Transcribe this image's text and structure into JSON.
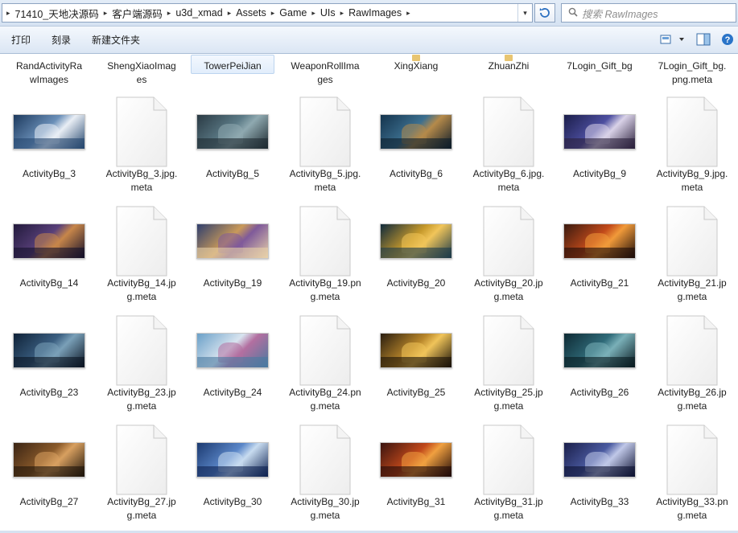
{
  "address": {
    "crumbs": [
      "71410_天地决源码",
      "客户端源码",
      "u3d_xmad",
      "Assets",
      "Game",
      "UIs",
      "RawImages"
    ],
    "search_placeholder": "搜索 RawImages"
  },
  "toolbar": {
    "print_label": "打印",
    "burn_label": "刻录",
    "new_folder_label": "新建文件夹"
  },
  "folders": [
    {
      "label": "RandActivityRa wImages",
      "lines": [
        "RandActivityRa",
        "wImages"
      ]
    },
    {
      "label": "ShengXiaoImag es",
      "lines": [
        "ShengXiaoImag",
        "es"
      ]
    },
    {
      "label": "TowerPeiJian",
      "lines": [
        "TowerPeiJian"
      ],
      "selected": true
    },
    {
      "label": "WeaponRollIma ges",
      "lines": [
        "WeaponRollIma",
        "ges"
      ]
    },
    {
      "label": "XingXiang",
      "lines": [
        "XingXiang"
      ]
    },
    {
      "label": "ZhuanZhi",
      "lines": [
        "ZhuanZhi"
      ]
    },
    {
      "label": "7Login_Gift_bg",
      "lines": [
        "7Login_Gift_bg"
      ]
    },
    {
      "label": "7Login_Gift_bg. png.meta",
      "lines": [
        "7Login_Gift_bg.",
        "png.meta"
      ]
    }
  ],
  "rows": [
    [
      {
        "type": "image",
        "lines": [
          "ActivityBg_3"
        ],
        "palette": [
          "#1d3a5e",
          "#6a8fb8",
          "#e9eef5",
          "#24466e"
        ]
      },
      {
        "type": "meta",
        "lines": [
          "ActivityBg_3.jpg.",
          "meta"
        ]
      },
      {
        "type": "image",
        "lines": [
          "ActivityBg_5"
        ],
        "palette": [
          "#2a3a44",
          "#5b7a86",
          "#8fa9b0",
          "#1e2a30"
        ]
      },
      {
        "type": "meta",
        "lines": [
          "ActivityBg_5.jpg.",
          "meta"
        ]
      },
      {
        "type": "image",
        "lines": [
          "ActivityBg_6"
        ],
        "palette": [
          "#14344d",
          "#3c6f8f",
          "#b58a4a",
          "#0c1c2a"
        ]
      },
      {
        "type": "meta",
        "lines": [
          "ActivityBg_6.jpg.",
          "meta"
        ]
      },
      {
        "type": "image",
        "lines": [
          "ActivityBg_9"
        ],
        "palette": [
          "#1b1d4a",
          "#4d4fa0",
          "#d9d2e8",
          "#2a1f3a"
        ]
      },
      {
        "type": "meta",
        "lines": [
          "ActivityBg_9.jpg.",
          "meta"
        ]
      }
    ],
    [
      {
        "type": "image",
        "lines": [
          "ActivityBg_14"
        ],
        "palette": [
          "#221a3c",
          "#59407a",
          "#c7864a",
          "#14102a"
        ]
      },
      {
        "type": "meta",
        "lines": [
          "ActivityBg_14.jp",
          "g.meta"
        ]
      },
      {
        "type": "image",
        "lines": [
          "ActivityBg_19"
        ],
        "palette": [
          "#2f3f6e",
          "#c99a5a",
          "#7f5a9a",
          "#e7d0a8"
        ]
      },
      {
        "type": "meta",
        "lines": [
          "ActivityBg_19.pn",
          "g.meta"
        ]
      },
      {
        "type": "image",
        "lines": [
          "ActivityBg_20"
        ],
        "palette": [
          "#0f2a3c",
          "#c79a2c",
          "#f1c55a",
          "#1c3a4a"
        ]
      },
      {
        "type": "meta",
        "lines": [
          "ActivityBg_20.jp",
          "g.meta"
        ]
      },
      {
        "type": "image",
        "lines": [
          "ActivityBg_21"
        ],
        "palette": [
          "#3a1a10",
          "#c24a1a",
          "#f19a3a",
          "#1c0c08"
        ]
      },
      {
        "type": "meta",
        "lines": [
          "ActivityBg_21.jp",
          "g.meta"
        ]
      }
    ],
    [
      {
        "type": "image",
        "lines": [
          "ActivityBg_23"
        ],
        "palette": [
          "#0f2238",
          "#3a5e80",
          "#7aa0b8",
          "#0a1422"
        ]
      },
      {
        "type": "meta",
        "lines": [
          "ActivityBg_23.jp",
          "g.meta"
        ]
      },
      {
        "type": "image",
        "lines": [
          "ActivityBg_24"
        ],
        "palette": [
          "#6aa0c8",
          "#d8e4ef",
          "#b36fa0",
          "#4a7aa0"
        ]
      },
      {
        "type": "meta",
        "lines": [
          "ActivityBg_24.pn",
          "g.meta"
        ]
      },
      {
        "type": "image",
        "lines": [
          "ActivityBg_25"
        ],
        "palette": [
          "#2a1e10",
          "#b8862a",
          "#f0c45a",
          "#1a1208"
        ]
      },
      {
        "type": "meta",
        "lines": [
          "ActivityBg_25.jp",
          "g.meta"
        ]
      },
      {
        "type": "image",
        "lines": [
          "ActivityBg_26"
        ],
        "palette": [
          "#0e2a34",
          "#2f6a78",
          "#7ab0b8",
          "#081a20"
        ]
      },
      {
        "type": "meta",
        "lines": [
          "ActivityBg_26.jp",
          "g.meta"
        ]
      }
    ],
    [
      {
        "type": "image",
        "lines": [
          "ActivityBg_27"
        ],
        "palette": [
          "#3a2414",
          "#8a5a2a",
          "#d8a060",
          "#1e140a"
        ]
      },
      {
        "type": "meta",
        "lines": [
          "ActivityBg_27.jp",
          "g.meta"
        ]
      },
      {
        "type": "image",
        "lines": [
          "ActivityBg_30"
        ],
        "palette": [
          "#1c3a70",
          "#5a86c8",
          "#c8dcf0",
          "#0e2250"
        ]
      },
      {
        "type": "meta",
        "lines": [
          "ActivityBg_30.jp",
          "g.meta"
        ]
      },
      {
        "type": "image",
        "lines": [
          "ActivityBg_31"
        ],
        "palette": [
          "#3a1410",
          "#c0481a",
          "#f0a040",
          "#200a08"
        ]
      },
      {
        "type": "meta",
        "lines": [
          "ActivityBg_31.jp",
          "g.meta"
        ]
      },
      {
        "type": "image",
        "lines": [
          "ActivityBg_33"
        ],
        "palette": [
          "#1a1f4a",
          "#4a5aa0",
          "#c0c8e8",
          "#0c1030"
        ]
      },
      {
        "type": "meta",
        "lines": [
          "ActivityBg_33.pn",
          "g.meta"
        ]
      }
    ]
  ]
}
